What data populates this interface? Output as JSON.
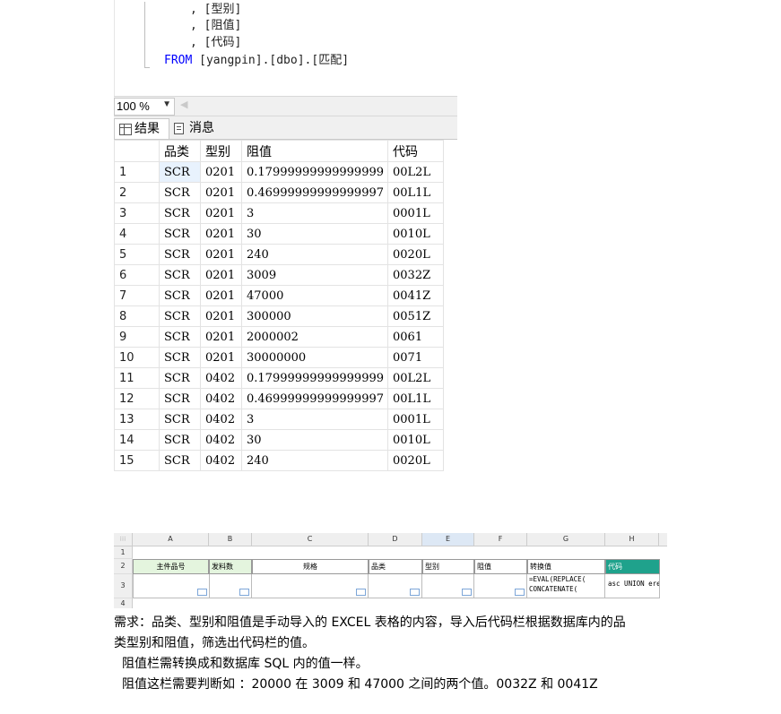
{
  "editor": {
    "lines": [
      ", [型别]",
      ", [阻值]",
      ", [代码]"
    ],
    "from_keyword": "FROM",
    "from_target": "[yangpin].[dbo].[匹配]"
  },
  "zoom": {
    "value": "100 %"
  },
  "tabs": {
    "results": "结果",
    "messages": "消息"
  },
  "grid": {
    "columns": [
      "品类",
      "型别",
      "阻值",
      "代码"
    ],
    "rows": [
      [
        "1",
        "SCR",
        "0201",
        "0.17999999999999999",
        "00L2L"
      ],
      [
        "2",
        "SCR",
        "0201",
        "0.46999999999999997",
        "00L1L"
      ],
      [
        "3",
        "SCR",
        "0201",
        "3",
        "0001L"
      ],
      [
        "4",
        "SCR",
        "0201",
        "30",
        "0010L"
      ],
      [
        "5",
        "SCR",
        "0201",
        "240",
        "0020L"
      ],
      [
        "6",
        "SCR",
        "0201",
        "3009",
        "0032Z"
      ],
      [
        "7",
        "SCR",
        "0201",
        "47000",
        "0041Z"
      ],
      [
        "8",
        "SCR",
        "0201",
        "300000",
        "0051Z"
      ],
      [
        "9",
        "SCR",
        "0201",
        "2000002",
        "0061"
      ],
      [
        "10",
        "SCR",
        "0201",
        "30000000",
        "0071"
      ],
      [
        "11",
        "SCR",
        "0402",
        "0.17999999999999999",
        "00L2L"
      ],
      [
        "12",
        "SCR",
        "0402",
        "0.46999999999999997",
        "00L1L"
      ],
      [
        "13",
        "SCR",
        "0402",
        "3",
        "0001L"
      ],
      [
        "14",
        "SCR",
        "0402",
        "30",
        "0010L"
      ],
      [
        "15",
        "SCR",
        "0402",
        "240",
        "0020L"
      ]
    ]
  },
  "excel": {
    "col_letters": [
      "A",
      "B",
      "C",
      "D",
      "E",
      "F",
      "G",
      "H"
    ],
    "row_numbers": [
      "1",
      "2",
      "3",
      "4"
    ],
    "headers": [
      "主件品号",
      "发料数",
      "规格",
      "品类",
      "型别",
      "阻值",
      "转换值",
      "代码"
    ],
    "formula": "=EVAL(REPLACE( CONCATENATE(",
    "h_content": "asc  UNION  ere"
  },
  "notes": {
    "line1": "需求：品类、型别和阻值是手动导入的 EXCEL 表格的内容，导入后代码栏根据数据库内的品",
    "line2": "类型别和阻值，筛选出代码栏的值。",
    "line3": "阻值栏需转换成和数据库 SQL 内的值一样。",
    "line4": "阻值这栏需要判断如 ：20000 在 3009 和 47000 之间的两个值。0032Z 和 0041Z"
  },
  "colors": {
    "kw": "#0000ff",
    "selected_cell": "#e8f2fd",
    "excel_teal": "#1fa28c",
    "excel_green": "#e4f5de"
  }
}
